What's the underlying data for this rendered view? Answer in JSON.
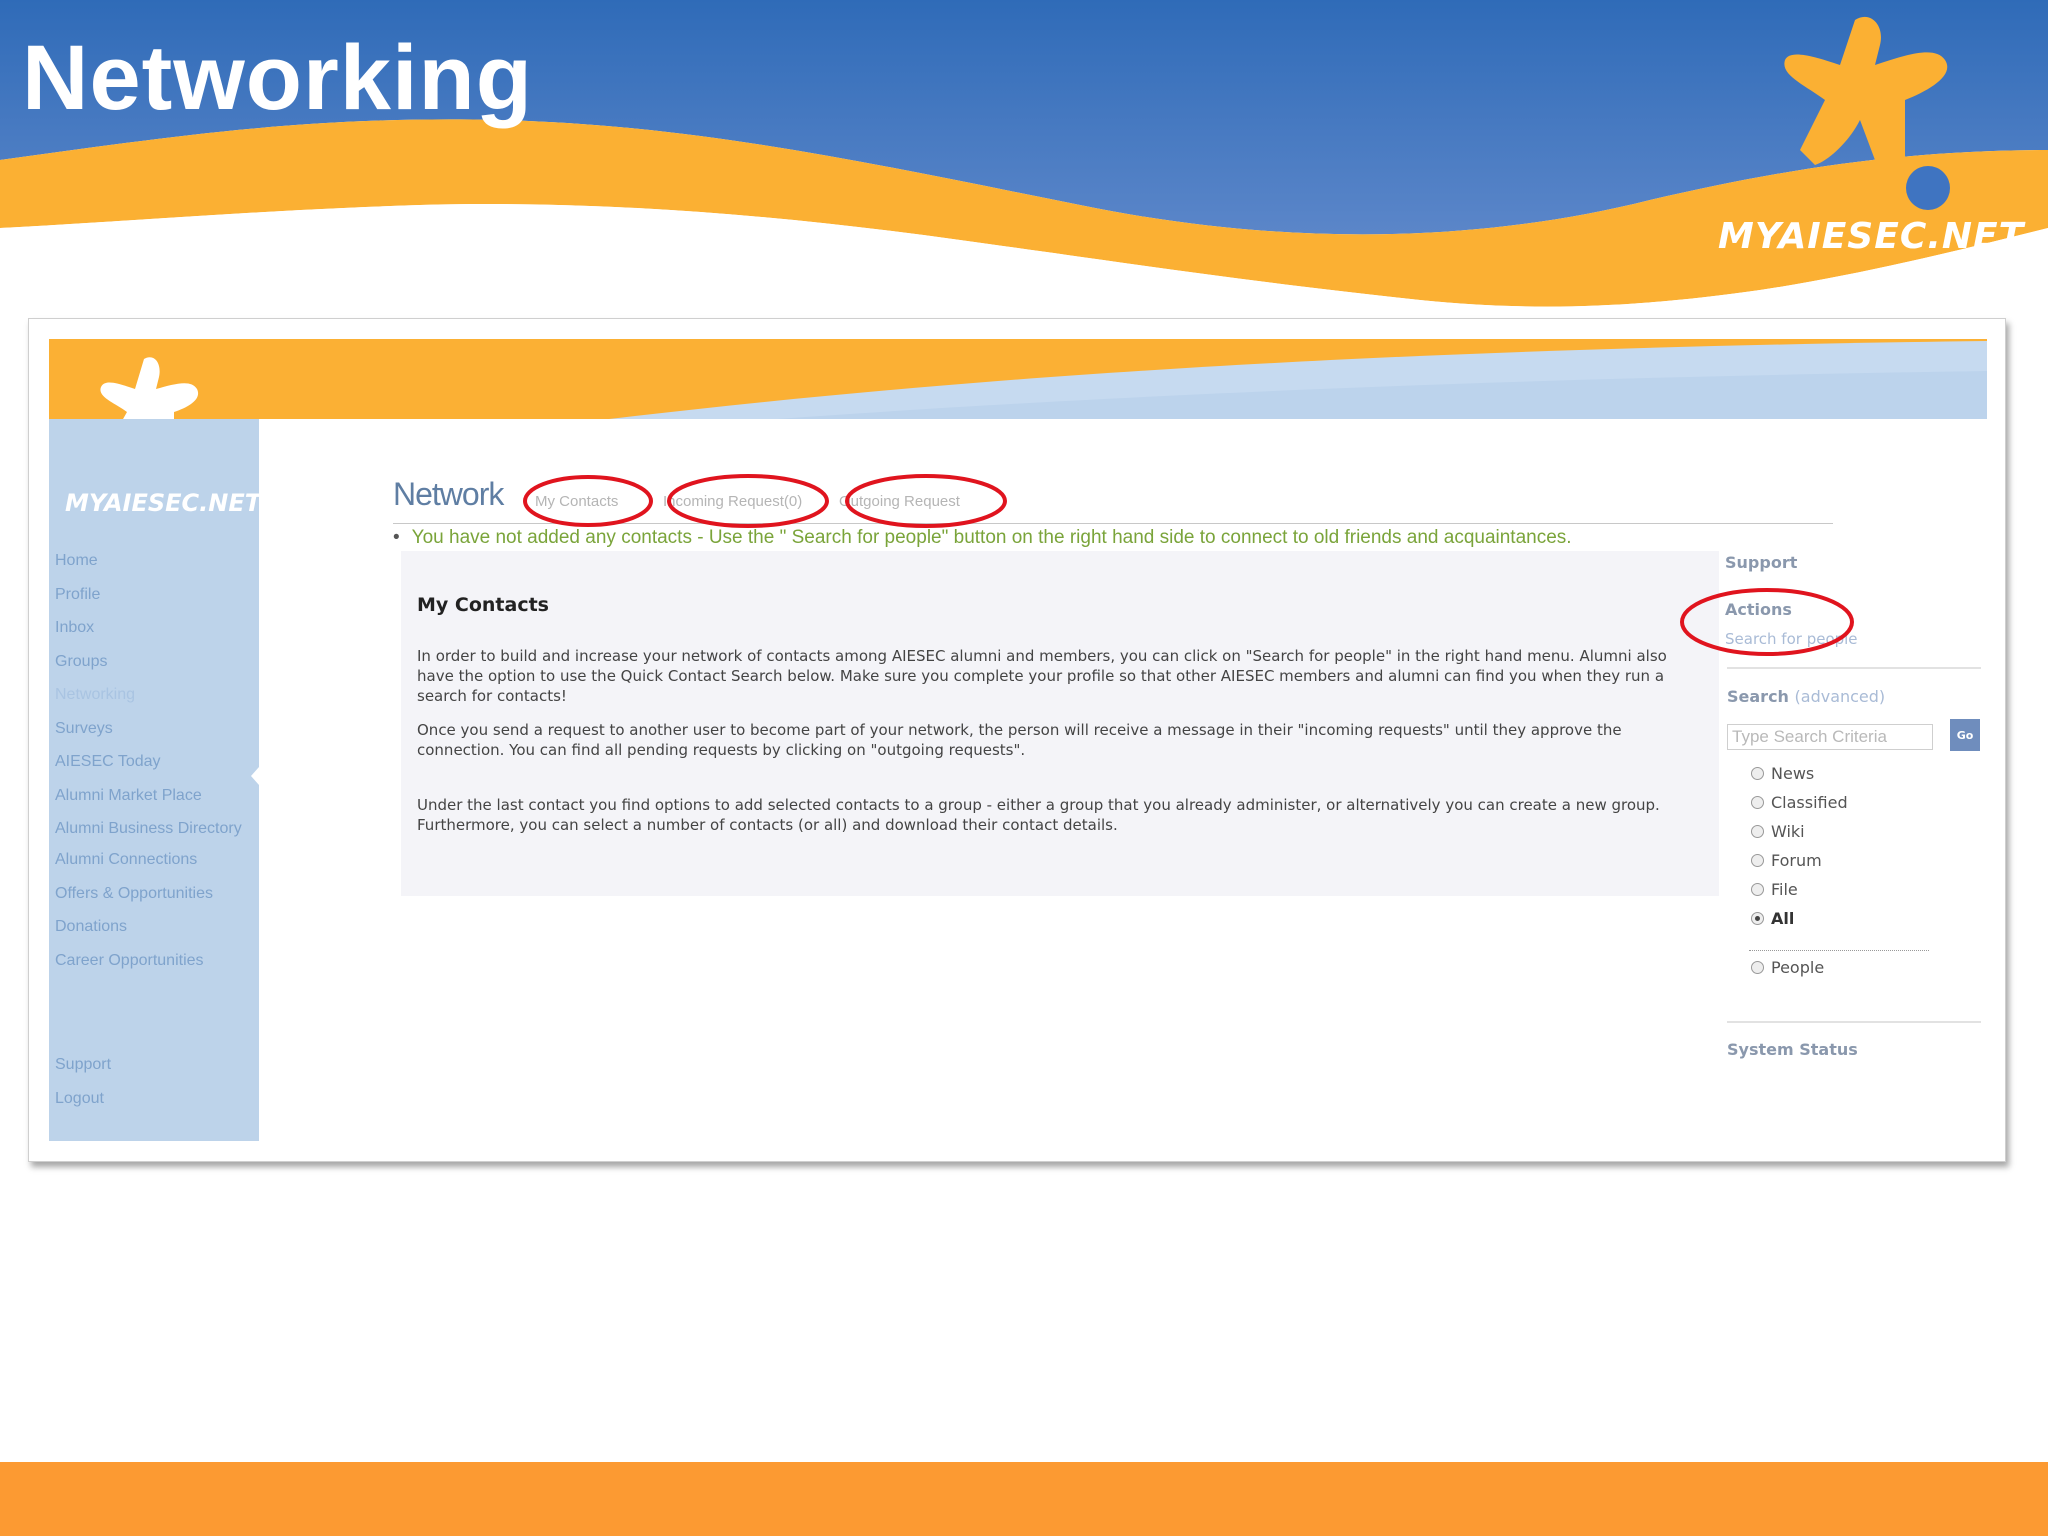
{
  "slide": {
    "title": "Networking",
    "brand_logo": "MYAIESEC.NET",
    "colors": {
      "header_blue": "#3f74c1",
      "wave_orange": "#fbb033",
      "bottom_bar": "#fc9a32"
    }
  },
  "site": {
    "logo": "MYAIESEC.NET",
    "nav": [
      "Home",
      "Profile",
      "Inbox",
      "Groups",
      "Networking",
      "Surveys",
      "AIESEC Today",
      "Alumni Market Place",
      "Alumni Business Directory",
      "Alumni Connections",
      "Offers & Opportunities",
      "Donations",
      "Career Opportunities"
    ],
    "nav_active": "Networking",
    "nav_lower": [
      "Support",
      "Logout"
    ]
  },
  "main": {
    "heading": "Network",
    "tabs": [
      "My Contacts",
      "Incoming Request(0)",
      "Outgoing Request"
    ],
    "notice": "You have not added any contacts - Use the \" Search for people\" button on the right hand side to connect to old friends and acquaintances.",
    "box_title": "My Contacts",
    "paragraphs": [
      "In order to build and increase your network of contacts among AIESEC alumni and members, you can click on \"Search for people\" in the right hand menu. Alumni also have the option to use the Quick Contact Search below. Make sure you complete your profile so that other AIESEC members and alumni can find you when they run a search for contacts!",
      "Once you send a request to another user to become part of your network, the person will receive a message in their \"incoming requests\" until they approve the connection. You can find all pending requests by clicking on \"outgoing requests\".",
      "Under the last contact you find options to add selected contacts to a group - either a group that you already administer, or alternatively you can create a new group. Furthermore, you can select a number of contacts (or all) and download their contact details."
    ]
  },
  "sidebar": {
    "support": "Support",
    "actions": "Actions",
    "search_people": "Search for people",
    "search_label": "Search",
    "search_advanced": "(advanced)",
    "search_placeholder": "Type Search Criteria",
    "go": "Go",
    "options": [
      "News",
      "Classified",
      "Wiki",
      "Forum",
      "File",
      "All"
    ],
    "selected_option": "All",
    "people": "People",
    "system_status": "System Status"
  },
  "annotations": {
    "circle_color": "#e0141e",
    "circled_items": [
      "My Contacts",
      "Incoming Request(0)",
      "Outgoing Request",
      "Actions"
    ]
  }
}
